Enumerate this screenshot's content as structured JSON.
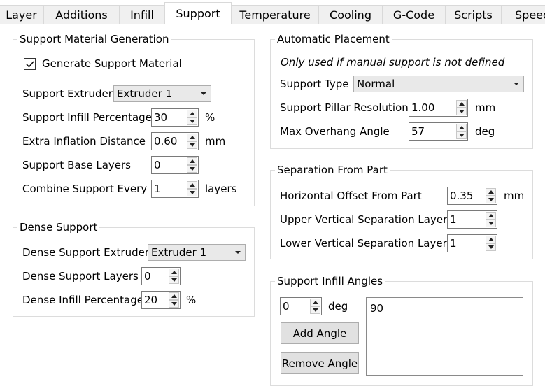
{
  "tabs": [
    "Layer",
    "Additions",
    "Infill",
    "Support",
    "Temperature",
    "Cooling",
    "G-Code",
    "Scripts",
    "Speed"
  ],
  "active_tab": "Support",
  "support_generation": {
    "title": "Support Material Generation",
    "generate_label": "Generate Support Material",
    "generate_checked": true,
    "extruder_label": "Support Extruder",
    "extruder_value": "Extruder 1",
    "infill_pct_label": "Support Infill Percentage",
    "infill_pct_value": "30",
    "infill_pct_unit": "%",
    "inflation_label": "Extra Inflation Distance",
    "inflation_value": "0.60",
    "inflation_unit": "mm",
    "base_layers_label": "Support Base Layers",
    "base_layers_value": "0",
    "combine_label": "Combine Support Every",
    "combine_value": "1",
    "combine_unit": "layers"
  },
  "dense_support": {
    "title": "Dense Support",
    "extruder_label": "Dense Support Extruder",
    "extruder_value": "Extruder 1",
    "layers_label": "Dense Support Layers",
    "layers_value": "0",
    "infill_pct_label": "Dense Infill Percentage",
    "infill_pct_value": "20",
    "infill_pct_unit": "%"
  },
  "automatic_placement": {
    "title": "Automatic Placement",
    "note": "Only used if manual support is not defined",
    "type_label": "Support Type",
    "type_value": "Normal",
    "pillar_label": "Support Pillar Resolution",
    "pillar_value": "1.00",
    "pillar_unit": "mm",
    "overhang_label": "Max Overhang Angle",
    "overhang_value": "57",
    "overhang_unit": "deg"
  },
  "separation": {
    "title": "Separation From Part",
    "horizontal_label": "Horizontal Offset From Part",
    "horizontal_value": "0.35",
    "horizontal_unit": "mm",
    "upper_label": "Upper Vertical Separation Layers",
    "upper_value": "1",
    "lower_label": "Lower Vertical Separation Layers",
    "lower_value": "1"
  },
  "infill_angles": {
    "title": "Support Infill Angles",
    "angle_value": "0",
    "angle_unit": "deg",
    "add_label": "Add Angle",
    "remove_label": "Remove Angle",
    "list": [
      "90"
    ]
  }
}
